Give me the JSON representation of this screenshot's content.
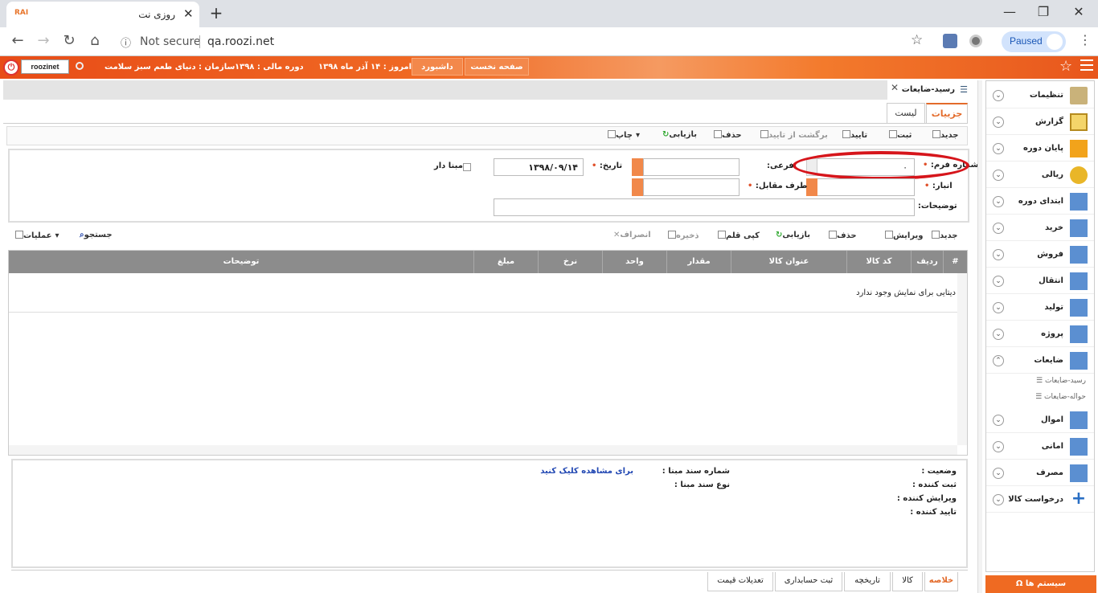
{
  "browser": {
    "tab_favicon": "RAI",
    "tab_title": "روزی نت",
    "tab_close": "✕",
    "new_tab": "+",
    "not_secure": "Not secure",
    "url": "qa.roozi.net",
    "paused": "Paused",
    "win_min": "—",
    "win_max": "❐",
    "win_close": "✕"
  },
  "header": {
    "user": "roozinet",
    "org": "سازمان : دنیای طعم سبز سلامت",
    "fiscal": "دوره مالی : ۱۳۹۸",
    "today": "امروز : ۱۴ آذر ماه ۱۳۹۸",
    "dashboard": "داشبورد",
    "home": "صفحه نخست"
  },
  "content_tab": {
    "title": "رسید-ضایعات"
  },
  "subtabs": {
    "details": "جزییات",
    "list": "لیست"
  },
  "toolbar": {
    "new": "جدید",
    "register": "ثبت",
    "approve": "تایید",
    "revert": "برگشت از تایید",
    "delete": "حذف",
    "refresh": "بازیابی",
    "print": "چاپ"
  },
  "form": {
    "form_number_label": "شماره فرم:",
    "form_number_value": "۰",
    "sub_label": "فرعی:",
    "date_label": "تاریخ:",
    "date_value": "۱۳۹۸/۰۹/۱۴",
    "base_label": "مبنا دار",
    "warehouse_label": "انبار:",
    "counterparty_label": "طرف مقابل:",
    "description_label": "توضیحات:"
  },
  "grid_toolbar": {
    "new": "جدید",
    "edit": "ویرایش",
    "delete": "حذف",
    "refresh": "بازیابی",
    "copy": "کپی قلم",
    "save": "ذخیره",
    "cancel": "انصراف",
    "search": "جستجو",
    "operations": "عملیات"
  },
  "grid": {
    "columns": [
      "#",
      "ردیف",
      "کد کالا",
      "عنوان کالا",
      "مقدار",
      "واحد",
      "نرخ",
      "مبلغ",
      "توضیحات"
    ],
    "empty_text": "دیتایی برای نمایش وجود ندارد"
  },
  "summary": {
    "status": "وضعیت :",
    "registrar": "ثبت کننده :",
    "editor": "ویرایش کننده :",
    "approver": "تایید کننده :",
    "source_number": "شماره سند مبنا :",
    "source_type": "نوع سند مبنا :",
    "source_link": "برای مشاهده کلیک کنید"
  },
  "bottom_tabs": [
    "خلاصه",
    "کالا",
    "تاریخچه",
    "ثبت حسابداری",
    "تعدیلات قیمت"
  ],
  "sidebar": {
    "items": [
      {
        "label": "تنظیمات",
        "icon": "settings-folder-icon"
      },
      {
        "label": "گزارش",
        "icon": "report-clipboard-icon"
      },
      {
        "label": "پایان دوره",
        "icon": "period-end-icon"
      },
      {
        "label": "ریالی",
        "icon": "currency-icon"
      },
      {
        "label": "ابتدای دوره",
        "icon": "table-star-icon"
      },
      {
        "label": "خرید",
        "icon": "table-star-icon"
      },
      {
        "label": "فروش",
        "icon": "table-star-icon"
      },
      {
        "label": "انتقال",
        "icon": "table-star-icon"
      },
      {
        "label": "تولید",
        "icon": "table-star-icon"
      },
      {
        "label": "پروژه",
        "icon": "table-star-icon"
      },
      {
        "label": "ضایعات",
        "icon": "table-star-icon"
      }
    ],
    "subitems": [
      "رسید-ضایعات",
      "حواله-ضایعات"
    ],
    "items2": [
      {
        "label": "اموال",
        "icon": "table-star-icon"
      },
      {
        "label": "امانی",
        "icon": "table-star-icon"
      },
      {
        "label": "مصرف",
        "icon": "table-star-icon"
      },
      {
        "label": "درخواست کالا",
        "icon": "plus-icon"
      }
    ],
    "system": "سیستم ها Ω"
  },
  "colors": {
    "accent": "#ef6a22",
    "highlight": "#d6151b",
    "grid_header": "#8c8c8c"
  }
}
